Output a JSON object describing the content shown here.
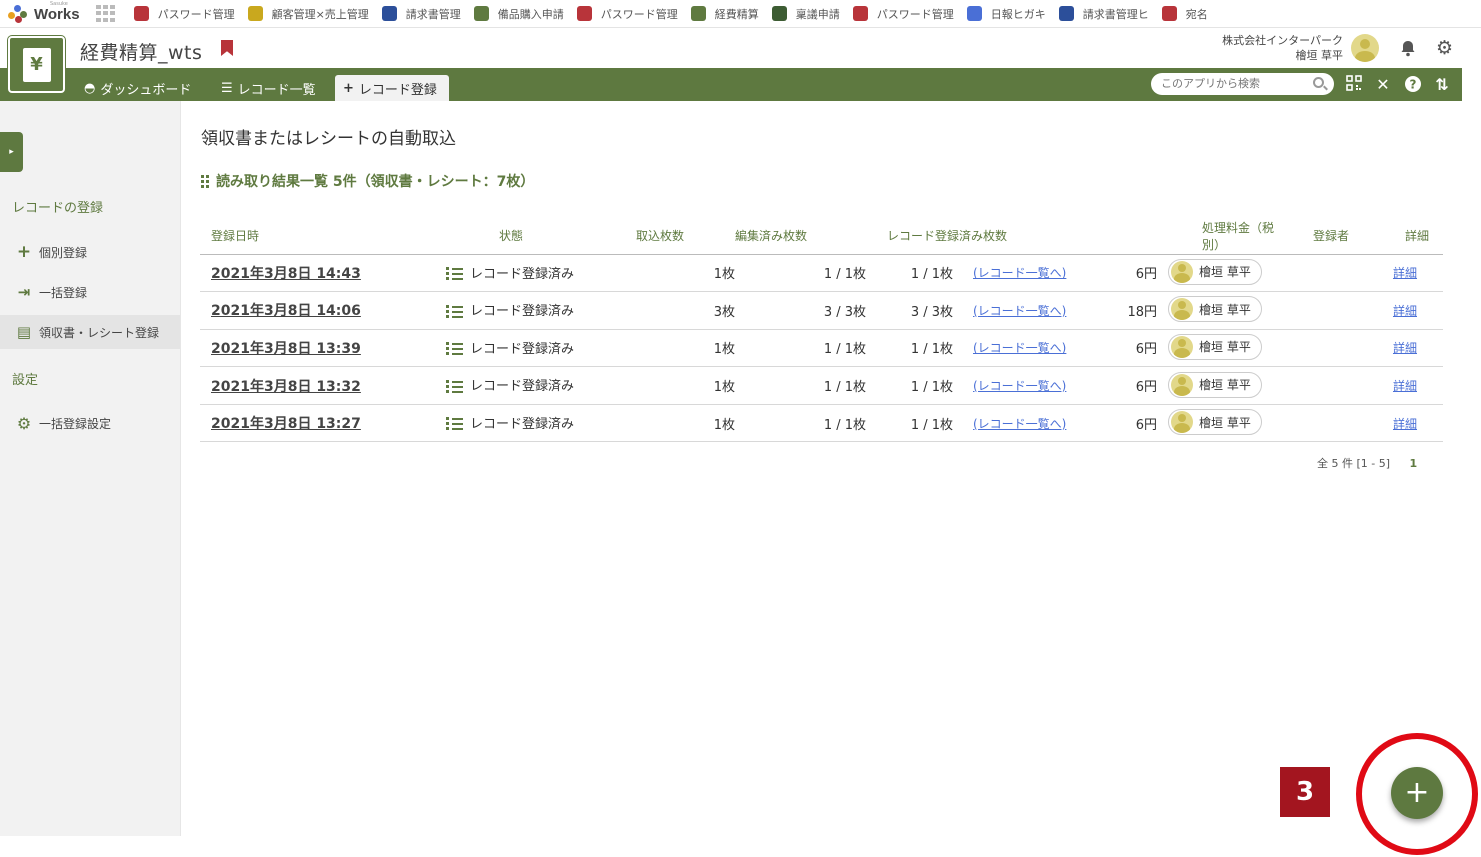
{
  "topbar": {
    "logo_text": "Works",
    "logo_sub": "Sasuke",
    "bookmarks": [
      {
        "label": "パスワード管理",
        "color": "#b8343a"
      },
      {
        "label": "顧客管理×売上管理",
        "color": "#c9a81e"
      },
      {
        "label": "請求書管理",
        "color": "#2c4f9a"
      },
      {
        "label": "備品購入申請",
        "color": "#5f7a40"
      },
      {
        "label": "パスワード管理",
        "color": "#b8343a"
      },
      {
        "label": "経費精算",
        "color": "#5f7a40"
      },
      {
        "label": "稟議申請",
        "color": "#3d5c33"
      },
      {
        "label": "パスワード管理",
        "color": "#b8343a"
      },
      {
        "label": "日報ヒガキ",
        "color": "#4a6fd6"
      },
      {
        "label": "請求書管理ヒ",
        "color": "#2c4f9a"
      },
      {
        "label": "宛名",
        "color": "#b8343a"
      }
    ]
  },
  "header": {
    "app_title": "経費精算_wts",
    "company": "株式会社インターパーク",
    "user": "檜垣 草平"
  },
  "nav": {
    "tabs": [
      {
        "label": "ダッシュボード",
        "icon": "dashboard-icon"
      },
      {
        "label": "レコード一覧",
        "icon": "list-icon"
      },
      {
        "label": "レコード登録",
        "icon": "plus-icon"
      }
    ],
    "search_placeholder": "このアプリから検索"
  },
  "sidebar": {
    "section1": "レコードの登録",
    "items": [
      {
        "label": "個別登録",
        "icon": "plus-icon"
      },
      {
        "label": "一括登録",
        "icon": "import-icon"
      },
      {
        "label": "領収書・レシート登録",
        "icon": "receipt-icon"
      }
    ],
    "section2": "設定",
    "settings_item": {
      "label": "一括登録設定",
      "icon": "gear-icon"
    }
  },
  "main": {
    "title": "領収書またはレシートの自動取込",
    "subtitle": "読み取り結果一覧 5件（領収書・レシート：7枚）",
    "columns": [
      "登録日時",
      "状態",
      "取込枚数",
      "編集済み枚数",
      "レコード登録済み枚数",
      "処理料金（税別）",
      "登録者",
      "詳細"
    ],
    "rows": [
      {
        "date": "2021年3月8日 14:43",
        "status": "レコード登録済み",
        "count": "1枚",
        "edited": "1 / 1枚",
        "registered": "1 / 1枚",
        "link": "(レコード一覧へ)",
        "fee": "6円",
        "user": "檜垣 草平",
        "detail": "詳細"
      },
      {
        "date": "2021年3月8日 14:06",
        "status": "レコード登録済み",
        "count": "3枚",
        "edited": "3 / 3枚",
        "registered": "3 / 3枚",
        "link": "(レコード一覧へ)",
        "fee": "18円",
        "user": "檜垣 草平",
        "detail": "詳細"
      },
      {
        "date": "2021年3月8日 13:39",
        "status": "レコード登録済み",
        "count": "1枚",
        "edited": "1 / 1枚",
        "registered": "1 / 1枚",
        "link": "(レコード一覧へ)",
        "fee": "6円",
        "user": "檜垣 草平",
        "detail": "詳細"
      },
      {
        "date": "2021年3月8日 13:32",
        "status": "レコード登録済み",
        "count": "1枚",
        "edited": "1 / 1枚",
        "registered": "1 / 1枚",
        "link": "(レコード一覧へ)",
        "fee": "6円",
        "user": "檜垣 草平",
        "detail": "詳細"
      },
      {
        "date": "2021年3月8日 13:27",
        "status": "レコード登録済み",
        "count": "1枚",
        "edited": "1 / 1枚",
        "registered": "1 / 1枚",
        "link": "(レコード一覧へ)",
        "fee": "6円",
        "user": "檜垣 草平",
        "detail": "詳細"
      }
    ],
    "pager_text": "全 5 件 [1 - 5]",
    "pager_page": "1"
  },
  "annotation": {
    "badge": "3",
    "fab_label": "+"
  },
  "colors": {
    "brand_green": "#5e7940",
    "annotation_red": "#e00a15",
    "badge_red": "#a3151f",
    "link_blue": "#4a6fd6"
  }
}
